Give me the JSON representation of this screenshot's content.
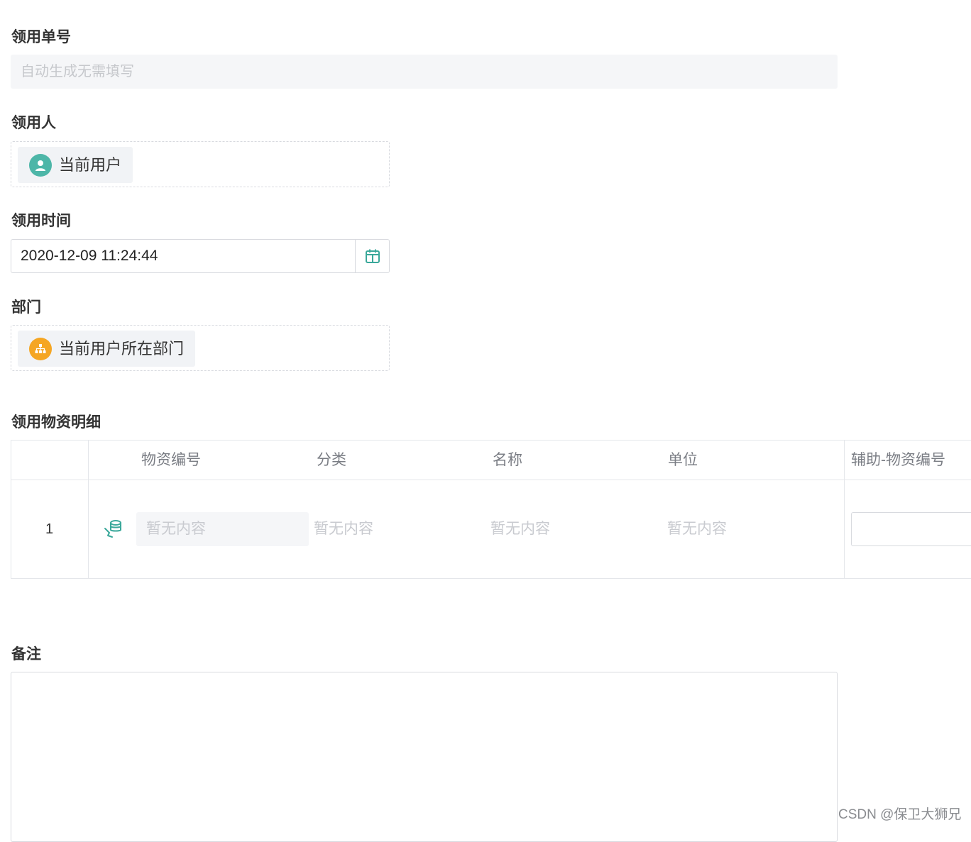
{
  "order_number": {
    "label": "领用单号",
    "placeholder": "自动生成无需填写"
  },
  "recipient": {
    "label": "领用人",
    "chip_text": "当前用户",
    "icon": "user-icon",
    "icon_color": "#4db6a8"
  },
  "receive_time": {
    "label": "领用时间",
    "value": "2020-12-09 11:24:44",
    "icon": "calendar-icon"
  },
  "department": {
    "label": "部门",
    "chip_text": "当前用户所在部门",
    "icon": "org-chart-icon",
    "icon_color": "#f5a623"
  },
  "materials": {
    "label": "领用物资明细",
    "columns": [
      "物资编号",
      "分类",
      "名称",
      "单位",
      "辅助-物资编号"
    ],
    "rows": [
      {
        "index": "1",
        "code_placeholder": "暂无内容",
        "category": "暂无内容",
        "name": "暂无内容",
        "unit": "暂无内容",
        "aux_code": ""
      }
    ],
    "pick_icon": "database-pick-icon"
  },
  "remarks": {
    "label": "备注",
    "value": ""
  },
  "watermark": "CSDN @保卫大狮兄",
  "colors": {
    "accent": "#3aa89a",
    "border": "#d8dadf",
    "placeholder": "#c6c8cc"
  }
}
